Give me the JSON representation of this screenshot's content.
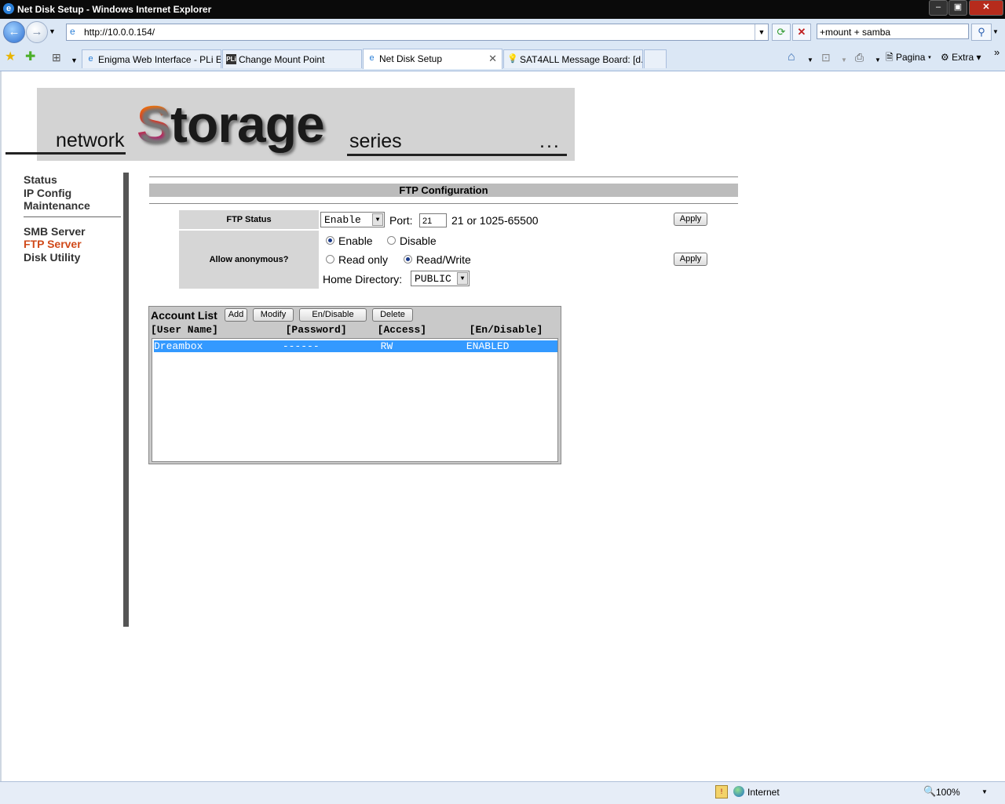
{
  "window": {
    "title": "Net Disk Setup - Windows Internet Explorer"
  },
  "address_bar": {
    "url": "http://10.0.0.154/",
    "search_value": "+mount + samba"
  },
  "tabs": [
    {
      "label": "Enigma Web Interface - PLi E..."
    },
    {
      "label": "Change Mount Point"
    },
    {
      "label": "Net Disk Setup"
    },
    {
      "label": "SAT4ALL Message Board: [d..."
    }
  ],
  "toolbar": {
    "page_label": "Pagina",
    "extra_label": "Extra"
  },
  "banner": {
    "network": "network",
    "storage_first": "S",
    "storage_rest": "torage",
    "series": "series",
    "dots": "..."
  },
  "sidebar": {
    "items": [
      {
        "label": "Status"
      },
      {
        "label": "IP Config"
      },
      {
        "label": "Maintenance"
      },
      {
        "label": "SMB Server"
      },
      {
        "label": "FTP Server"
      },
      {
        "label": "Disk Utility"
      }
    ]
  },
  "ftp": {
    "heading": "FTP Configuration",
    "status_label": "FTP Status",
    "status_value": "Enable",
    "port_label": "Port:",
    "port_value": "21",
    "port_range": "21 or 1025-65500",
    "apply_label": "Apply",
    "anon_label": "Allow anonymous?",
    "anon_enable": "Enable",
    "anon_disable": "Disable",
    "read_only": "Read only",
    "read_write": "Read/Write",
    "home_dir_label": "Home Directory:",
    "home_dir_value": "PUBLIC"
  },
  "accounts": {
    "title": "Account List",
    "buttons": {
      "add": "Add",
      "modify": "Modify",
      "endisable": "En/Disable",
      "delete": "Delete"
    },
    "headers": "[User Name]           [Password]     [Access]       [En/Disable]",
    "rows": [
      {
        "text": "Dreambox             ------          RW            ENABLED"
      }
    ]
  },
  "statusbar": {
    "zone": "Internet",
    "zoom": "100%"
  }
}
